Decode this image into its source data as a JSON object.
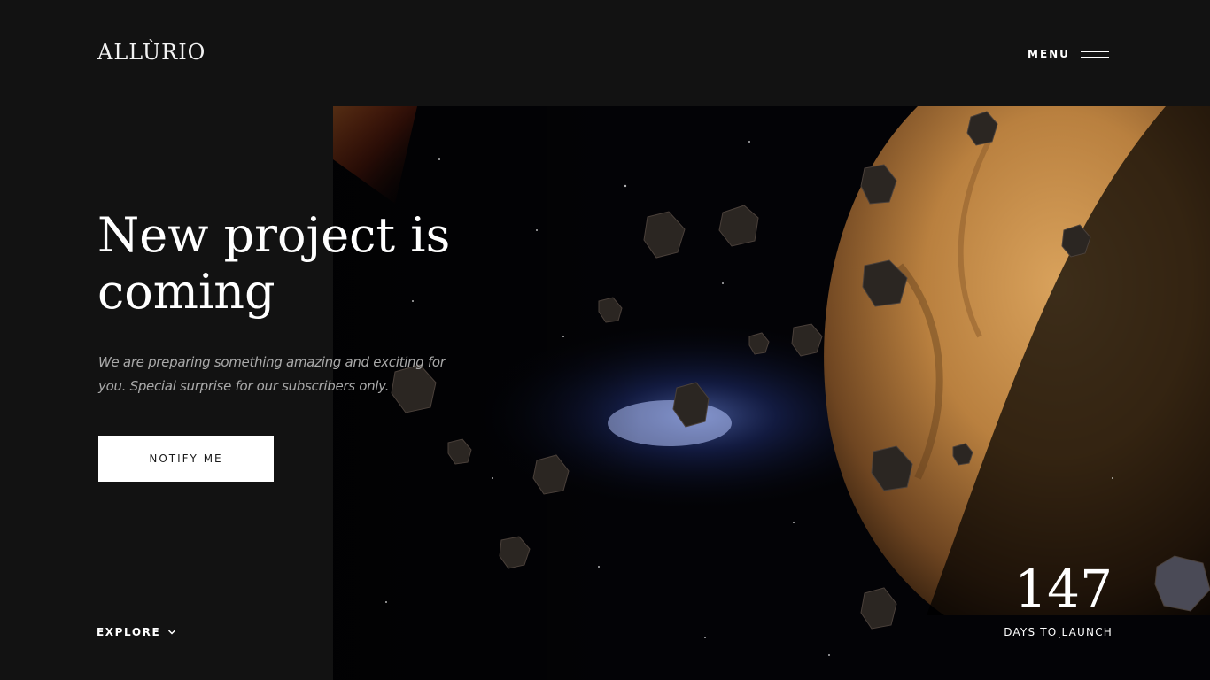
{
  "header": {
    "logo": "ALLÙRIO",
    "menu_label": "MENU"
  },
  "hero": {
    "headline": "New project is coming",
    "subtitle": "We are preparing something amazing and exciting for you. Special surprise for our subscribers only.",
    "notify_label": "NOTIFY ME"
  },
  "footer": {
    "explore_label": "EXPLORE",
    "countdown_value": "147",
    "countdown_label": "DAYS TO LAUNCH"
  },
  "icons": {
    "menu": "hamburger-icon",
    "explore": "chevron-down-icon"
  },
  "colors": {
    "background": "#121212",
    "text": "#ffffff",
    "muted_text": "#a9a9a9",
    "button_bg": "#ffffff",
    "button_text": "#1a1a1a"
  }
}
